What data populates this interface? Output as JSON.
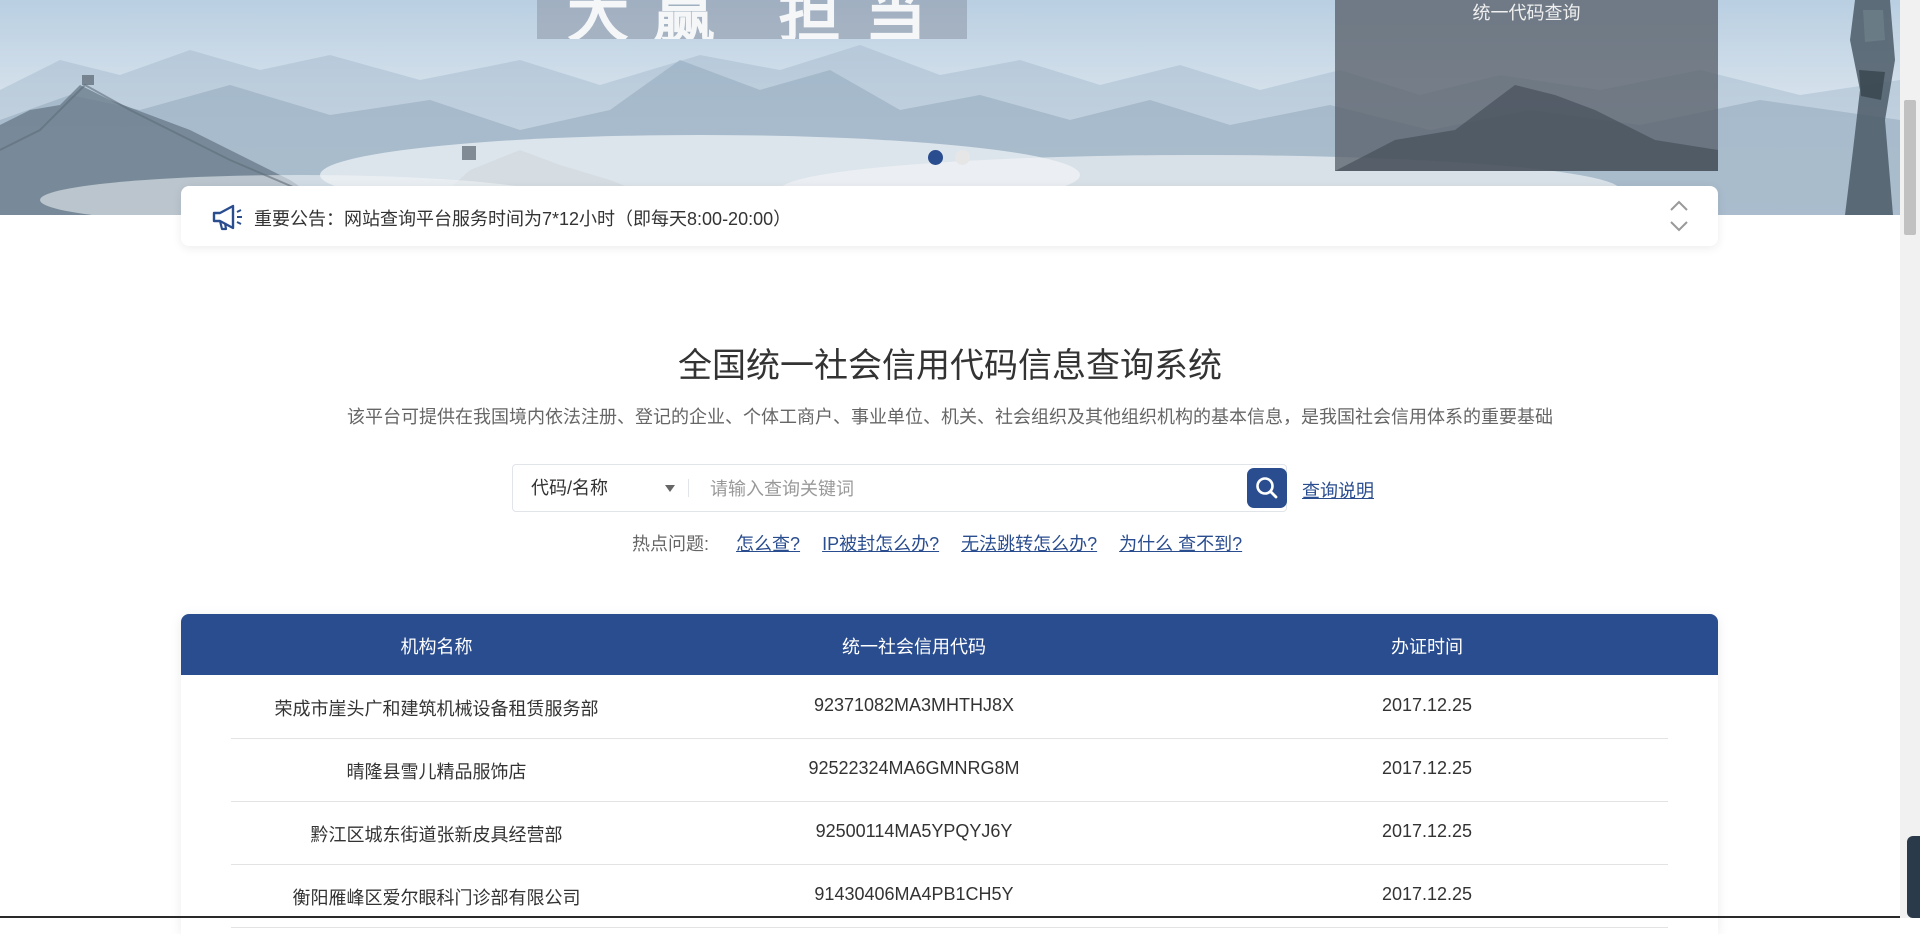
{
  "banner": {
    "title_text": "大赢 担当",
    "side_card_title": "统一代码查询",
    "carousel_dots": 2,
    "active_dot": 0
  },
  "notice": {
    "text": "重要公告：网站查询平台服务时间为7*12小时（即每天8:00-20:00）"
  },
  "header": {
    "title": "全国统一社会信用代码信息查询系统",
    "subtitle": "该平台可提供在我国境内依法注册、登记的企业、个体工商户、事业单位、机关、社会组织及其他组织机构的基本信息，是我国社会信用体系的重要基础"
  },
  "search": {
    "select_value": "代码/名称",
    "placeholder": "请输入查询关键词",
    "help_link": "查询说明"
  },
  "hot": {
    "label": "热点问题:",
    "links": [
      "怎么查?",
      "IP被封怎么办?",
      "无法跳转怎么办?",
      "为什么 查不到?"
    ]
  },
  "table": {
    "headers": [
      "机构名称",
      "统一社会信用代码",
      "办证时间"
    ],
    "rows": [
      [
        "荣成市崖头广和建筑机械设备租赁服务部",
        "92371082MA3MHTHJ8X",
        "2017.12.25"
      ],
      [
        "晴隆县雪儿精品服饰店",
        "92522324MA6GMNRG8M",
        "2017.12.25"
      ],
      [
        "黔江区城东街道张新皮具经营部",
        "92500114MA5YPQYJ6Y",
        "2017.12.25"
      ],
      [
        "衡阳雁峰区爱尔眼科门诊部有限公司",
        "91430406MA4PB1CH5Y",
        "2017.12.25"
      ]
    ]
  },
  "colors": {
    "primary": "#2a4d8f",
    "text": "#333333",
    "muted": "#666666"
  }
}
